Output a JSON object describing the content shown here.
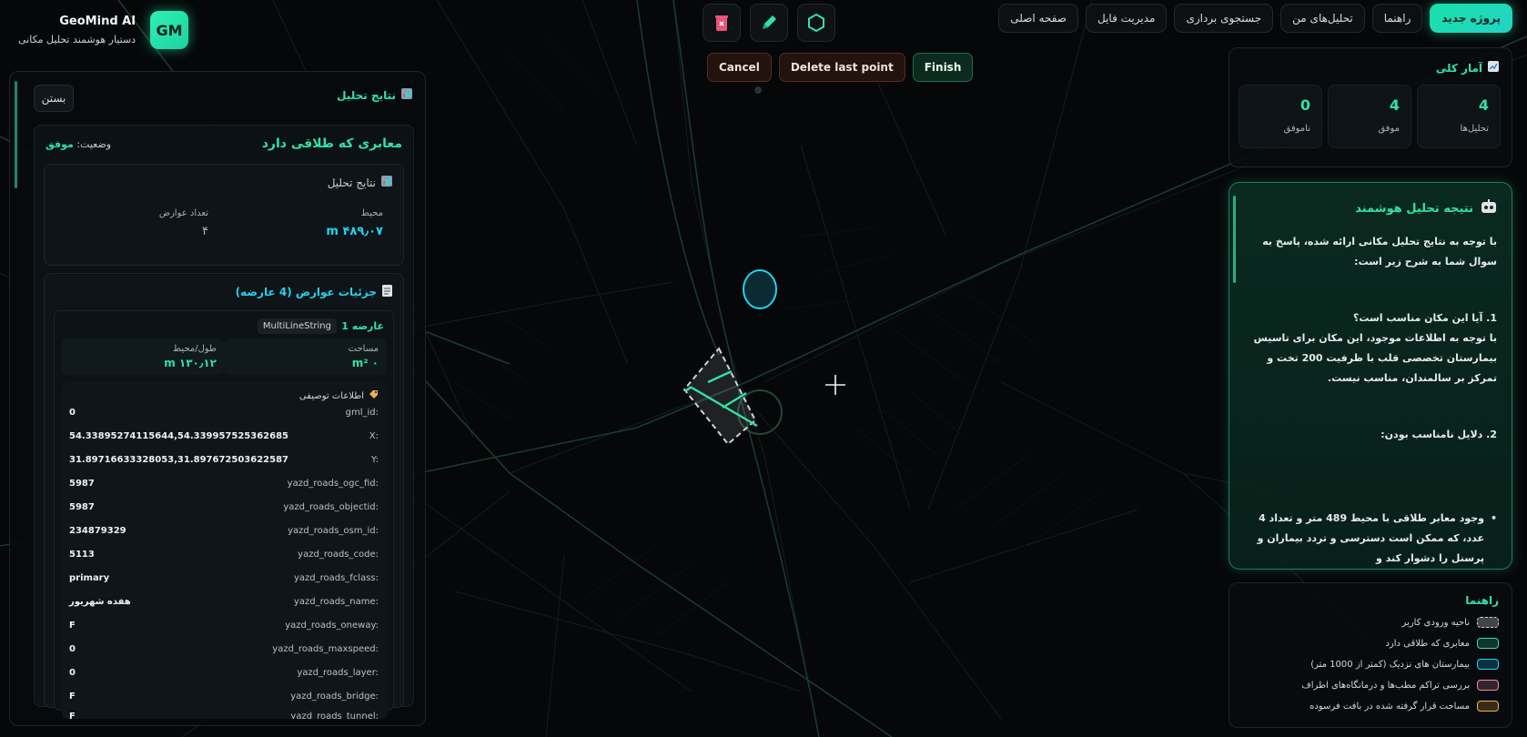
{
  "brand": {
    "name": "GeoMind AI",
    "subtitle": "دستیار هوشمند تحلیل مکانی",
    "logo": "GM"
  },
  "nav": {
    "items": [
      "صفحه اصلی",
      "مدیریت فایل",
      "جستجوی برداری",
      "تحلیل‌های من",
      "راهنما",
      "پروژه جدید"
    ]
  },
  "draw_tools": {
    "icons": [
      "trash-icon",
      "pencil-icon",
      "hexagon-icon"
    ],
    "cancel": "Cancel",
    "delete_last": "Delete last point",
    "finish": "Finish"
  },
  "results": {
    "title": "نتایج تحلیل",
    "close": "بستن",
    "query_title": "معابری که طلاقی دارد",
    "status_label": "وضعیت:",
    "status_value": "موفق",
    "stats_title": "نتایج تحلیل",
    "perimeter_label": "محیط",
    "perimeter_value": "m ۴۸۹٫۰۷",
    "count_label": "تعداد عوارض",
    "count_value": "۴",
    "features_title": "جزئیات عوارض (4 عارضه)",
    "feature": {
      "name": "عارضه 1",
      "type": "MultiLineString",
      "area_label": "مساحت",
      "area_value": "m² ۰",
      "length_label": "طول/محیط",
      "length_value": "m ۱۳۰٫۱۲",
      "desc_title": "اطلاعات توصیفی",
      "attributes": [
        {
          "k": "gml_id:",
          "v": "0"
        },
        {
          "k": "X:",
          "v": "54.33895274115644,54.339957525362685"
        },
        {
          "k": "Y:",
          "v": "31.89716633328053,31.897672503622587"
        },
        {
          "k": "yazd_roads_ogc_fid:",
          "v": "5987"
        },
        {
          "k": "yazd_roads_objectid:",
          "v": "5987"
        },
        {
          "k": "yazd_roads_osm_id:",
          "v": "234879329"
        },
        {
          "k": "yazd_roads_code:",
          "v": "5113"
        },
        {
          "k": "yazd_roads_fclass:",
          "v": "primary"
        },
        {
          "k": "yazd_roads_name:",
          "v": "هفده شهریور"
        },
        {
          "k": "yazd_roads_oneway:",
          "v": "F"
        },
        {
          "k": "yazd_roads_maxspeed:",
          "v": "0"
        },
        {
          "k": "yazd_roads_layer:",
          "v": "0"
        },
        {
          "k": "yazd_roads_bridge:",
          "v": "F"
        },
        {
          "k": "yazd_roads_tunnel:",
          "v": "F"
        }
      ]
    }
  },
  "overall": {
    "title": "آمار کلی",
    "items": [
      {
        "n": "4",
        "l": "تحلیل‌ها"
      },
      {
        "n": "4",
        "l": "موفق"
      },
      {
        "n": "0",
        "l": "ناموفق"
      }
    ]
  },
  "ai": {
    "title": "نتیجه تحلیل هوشمند",
    "p1": "با توجه به نتایج تحلیل مکانی ارائه شده، پاسخ به سوال شما به شرح زیر است:",
    "q1": "1. آیا این مکان مناسب است؟",
    "a1": "با توجه به اطلاعات موجود، این مکان برای تاسیس بیمارستان تخصصی قلب با ظرفیت 200 تخت و تمرکز بر سالمندان، مناسب نیست.",
    "q2": "2. دلایل نامناسب بودن:",
    "b1": "وجود معابر طلاقی با محیط 489 متر و تعداد 4 عدد، که ممکن است دسترسی و تردد بیماران و پرسنل را دشوار کند و"
  },
  "legend": {
    "title": "راهنما",
    "items": [
      {
        "t": "ناحیه ورودی کاربر",
        "c": "#cfd4d8"
      },
      {
        "t": "معابری که طلاقی دارد",
        "c": "#2fe3a5"
      },
      {
        "t": "بیمارستان های نزدیک (کمتر از 1000 متر)",
        "c": "#22d3ee"
      },
      {
        "t": "بررسی تراکم مطب‌ها و درمانگاه‌های اطراف",
        "c": "#f28aa0"
      },
      {
        "t": "مساحت قرار گرفته شده در بافت فرسوده",
        "c": "#f3b04a"
      }
    ]
  }
}
